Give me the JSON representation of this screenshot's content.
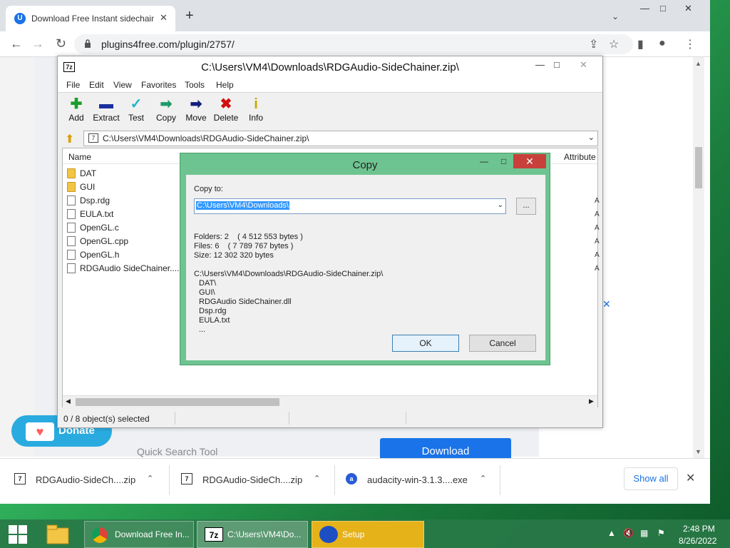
{
  "browser": {
    "tab_title": "Download Free Instant sidechain",
    "tab_close": "✕",
    "new_tab": "+",
    "url": "plugins4free.com/plugin/2757/"
  },
  "page": {
    "donate_label": "Donate",
    "quick_search": "Quick Search Tool",
    "download_button": "Download"
  },
  "downloads": {
    "items": [
      {
        "name": "RDGAudio-SideCh....zip"
      },
      {
        "name": "RDGAudio-SideCh....zip"
      },
      {
        "name": "audacity-win-3.1.3....exe"
      }
    ],
    "show_all": "Show all"
  },
  "zip": {
    "title": "C:\\Users\\VM4\\Downloads\\RDGAudio-SideChainer.zip\\",
    "menu": [
      "File",
      "Edit",
      "View",
      "Favorites",
      "Tools",
      "Help"
    ],
    "toolbar": [
      "Add",
      "Extract",
      "Test",
      "Copy",
      "Move",
      "Delete",
      "Info"
    ],
    "address": "C:\\Users\\VM4\\Downloads\\RDGAudio-SideChainer.zip\\",
    "columns": {
      "name": "Name",
      "attributes": "Attribute"
    },
    "files": [
      {
        "name": "DAT",
        "kind": "folder"
      },
      {
        "name": "GUI",
        "kind": "folder"
      },
      {
        "name": "Dsp.rdg",
        "kind": "file"
      },
      {
        "name": "EULA.txt",
        "kind": "file"
      },
      {
        "name": "OpenGL.c",
        "kind": "file"
      },
      {
        "name": "OpenGL.cpp",
        "kind": "file"
      },
      {
        "name": "OpenGL.h",
        "kind": "file"
      },
      {
        "name": "RDGAudio SideChainer....",
        "kind": "file"
      }
    ],
    "status": "0 / 8 object(s) selected"
  },
  "dialog": {
    "title": "Copy",
    "copy_to_label": "Copy to:",
    "destination": "C:\\Users\\VM4\\Downloads\\",
    "browse": "...",
    "folders": "Folders: 2    ( 4 512 553 bytes )",
    "files": "Files: 6    ( 7 789 767 bytes )",
    "size": "Size: 12 302 320 bytes",
    "source": "C:\\Users\\VM4\\Downloads\\RDGAudio-SideChainer.zip\\",
    "items": [
      "DAT\\",
      "GUI\\",
      "RDGAudio SideChainer.dll",
      "Dsp.rdg",
      "EULA.txt",
      "..."
    ],
    "ok": "OK",
    "cancel": "Cancel"
  },
  "taskbar": {
    "chrome": "Download Free In...",
    "zip": "C:\\Users\\VM4\\Do...",
    "setup": "Setup",
    "time": "2:48 PM",
    "date": "8/26/2022"
  }
}
